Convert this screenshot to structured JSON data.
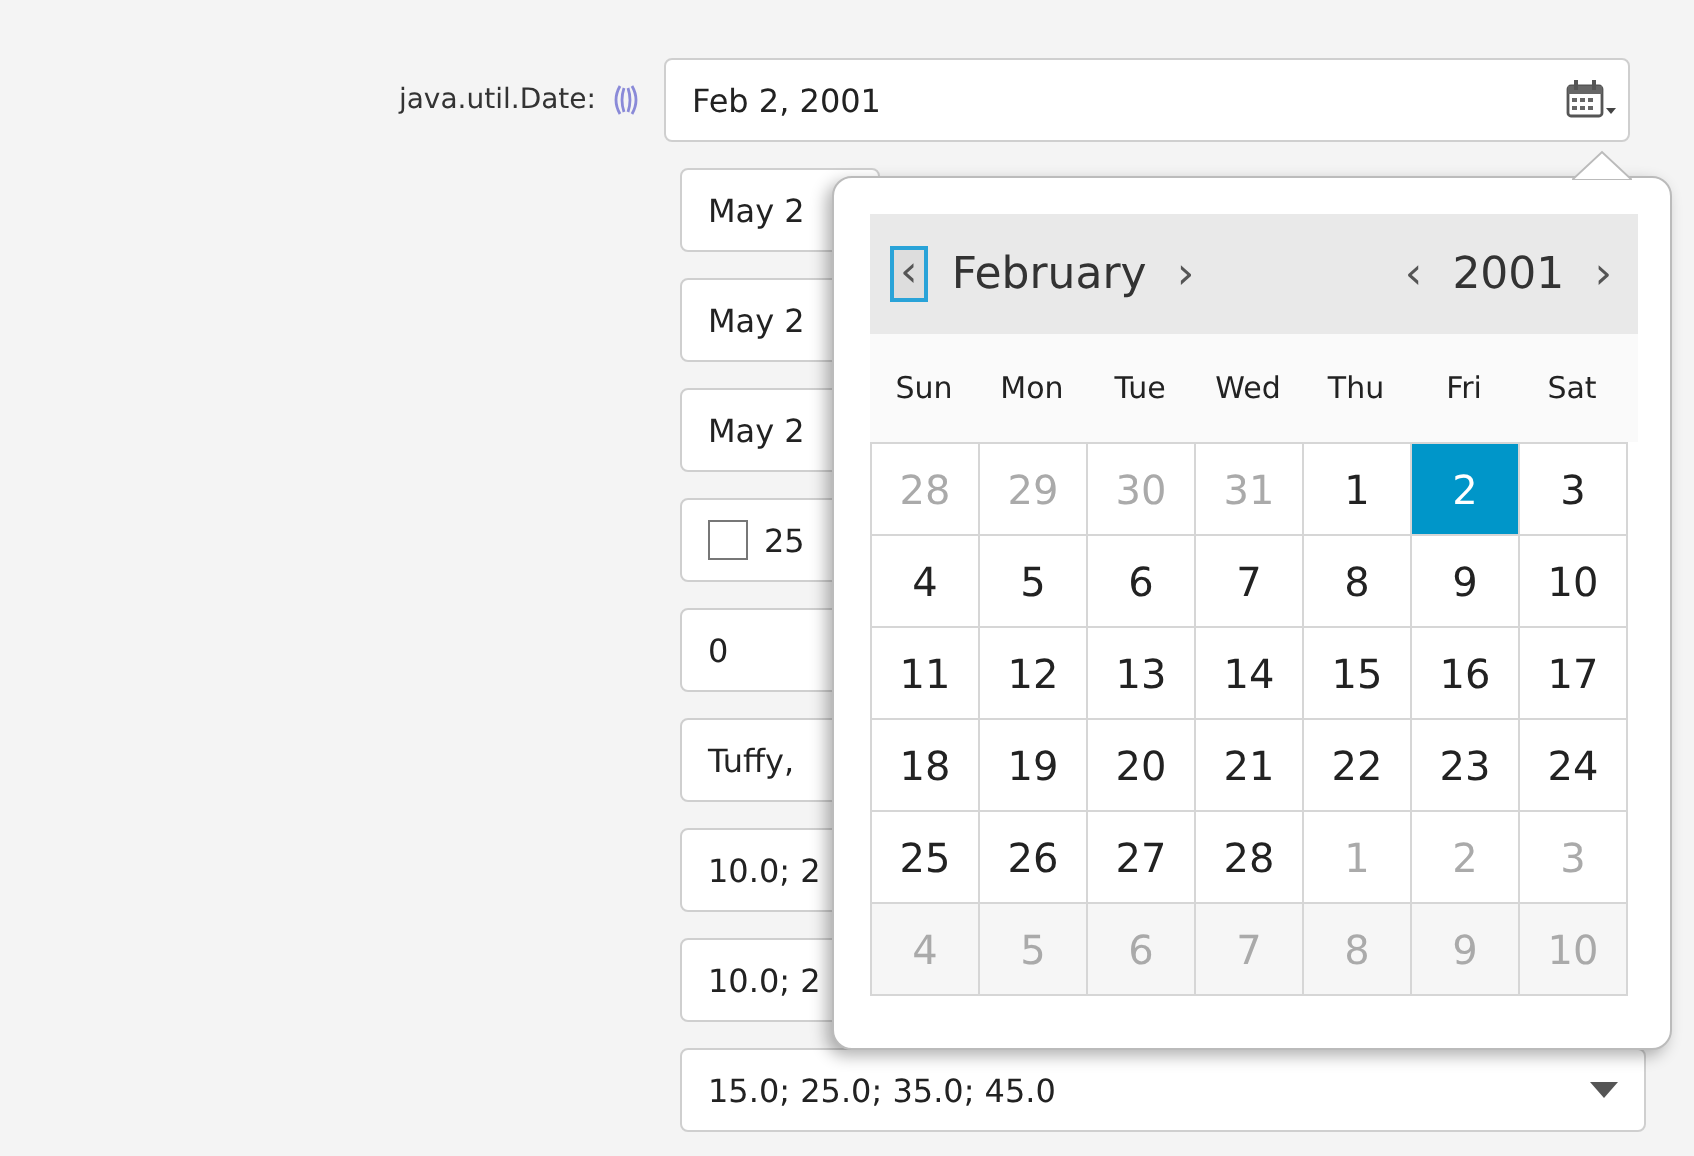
{
  "date_field": {
    "label": "java.util.Date:",
    "value": "Feb 2, 2001"
  },
  "fields": [
    {
      "kind": "text",
      "value": "May 2"
    },
    {
      "kind": "text",
      "value": "May 2"
    },
    {
      "kind": "text",
      "value": "May 2"
    },
    {
      "kind": "checkbox",
      "checked": false,
      "value": "25"
    },
    {
      "kind": "text",
      "value": "0"
    },
    {
      "kind": "text",
      "value": "Tuffy,"
    },
    {
      "kind": "text",
      "value": "10.0; 2"
    },
    {
      "kind": "text",
      "value": "10.0; 2"
    }
  ],
  "combo": {
    "value": "15.0; 25.0; 35.0; 45.0"
  },
  "calendar": {
    "prev_month": "‹",
    "month": "February",
    "next_month": "›",
    "prev_year": "‹",
    "year": "2001",
    "next_year": "›",
    "weekdays": [
      "Sun",
      "Mon",
      "Tue",
      "Wed",
      "Thu",
      "Fri",
      "Sat"
    ],
    "weeks": [
      [
        {
          "day": "28",
          "muted": true,
          "selected": false
        },
        {
          "day": "29",
          "muted": true,
          "selected": false
        },
        {
          "day": "30",
          "muted": true,
          "selected": false
        },
        {
          "day": "31",
          "muted": true,
          "selected": false
        },
        {
          "day": "1",
          "muted": false,
          "selected": false
        },
        {
          "day": "2",
          "muted": false,
          "selected": true
        },
        {
          "day": "3",
          "muted": false,
          "selected": false
        }
      ],
      [
        {
          "day": "4",
          "muted": false,
          "selected": false
        },
        {
          "day": "5",
          "muted": false,
          "selected": false
        },
        {
          "day": "6",
          "muted": false,
          "selected": false
        },
        {
          "day": "7",
          "muted": false,
          "selected": false
        },
        {
          "day": "8",
          "muted": false,
          "selected": false
        },
        {
          "day": "9",
          "muted": false,
          "selected": false
        },
        {
          "day": "10",
          "muted": false,
          "selected": false
        }
      ],
      [
        {
          "day": "11",
          "muted": false,
          "selected": false
        },
        {
          "day": "12",
          "muted": false,
          "selected": false
        },
        {
          "day": "13",
          "muted": false,
          "selected": false
        },
        {
          "day": "14",
          "muted": false,
          "selected": false
        },
        {
          "day": "15",
          "muted": false,
          "selected": false
        },
        {
          "day": "16",
          "muted": false,
          "selected": false
        },
        {
          "day": "17",
          "muted": false,
          "selected": false
        }
      ],
      [
        {
          "day": "18",
          "muted": false,
          "selected": false
        },
        {
          "day": "19",
          "muted": false,
          "selected": false
        },
        {
          "day": "20",
          "muted": false,
          "selected": false
        },
        {
          "day": "21",
          "muted": false,
          "selected": false
        },
        {
          "day": "22",
          "muted": false,
          "selected": false
        },
        {
          "day": "23",
          "muted": false,
          "selected": false
        },
        {
          "day": "24",
          "muted": false,
          "selected": false
        }
      ],
      [
        {
          "day": "25",
          "muted": false,
          "selected": false
        },
        {
          "day": "26",
          "muted": false,
          "selected": false
        },
        {
          "day": "27",
          "muted": false,
          "selected": false
        },
        {
          "day": "28",
          "muted": false,
          "selected": false
        },
        {
          "day": "1",
          "muted": true,
          "selected": false
        },
        {
          "day": "2",
          "muted": true,
          "selected": false
        },
        {
          "day": "3",
          "muted": true,
          "selected": false
        }
      ],
      [
        {
          "day": "4",
          "muted": true,
          "selected": false
        },
        {
          "day": "5",
          "muted": true,
          "selected": false
        },
        {
          "day": "6",
          "muted": true,
          "selected": false
        },
        {
          "day": "7",
          "muted": true,
          "selected": false
        },
        {
          "day": "8",
          "muted": true,
          "selected": false
        },
        {
          "day": "9",
          "muted": true,
          "selected": false
        },
        {
          "day": "10",
          "muted": true,
          "selected": false
        }
      ]
    ]
  }
}
